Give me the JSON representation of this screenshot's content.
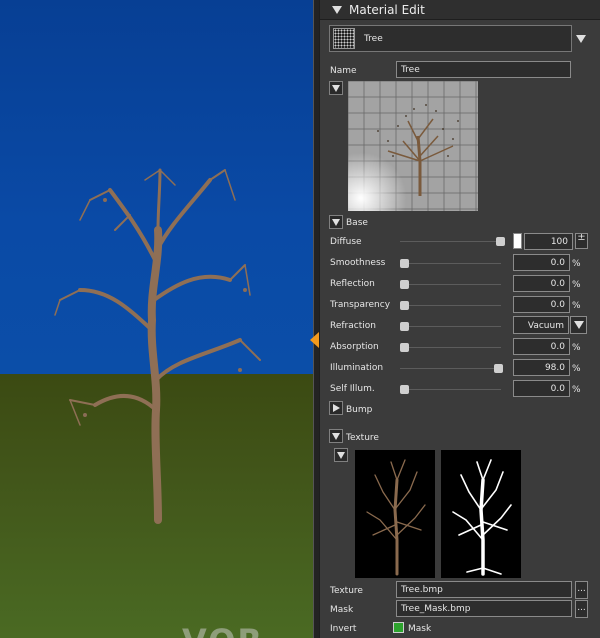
{
  "viewport": {
    "sky_color": "#0b4ea8",
    "ground_color": "#42561a",
    "watermark": "VOR"
  },
  "panel": {
    "title": "Material Edit",
    "material_selector": {
      "value": "Tree"
    },
    "name": {
      "label": "Name",
      "value": "Tree"
    },
    "sections": {
      "base": "Base",
      "bump": "Bump",
      "texture": "Texture"
    },
    "base_properties": [
      {
        "label": "Diffuse",
        "value": "100",
        "unit": "",
        "level": 1.0
      },
      {
        "label": "Smoothness",
        "value": "0.0",
        "unit": "%",
        "level": 0.0
      },
      {
        "label": "Reflection",
        "value": "0.0",
        "unit": "%",
        "level": 0.0
      },
      {
        "label": "Transparency",
        "value": "0.0",
        "unit": "%",
        "level": 0.0
      },
      {
        "label": "Refraction",
        "value": "Vacuum",
        "unit": "",
        "level": 0.0
      },
      {
        "label": "Absorption",
        "value": "0.0",
        "unit": "%",
        "level": 0.0
      },
      {
        "label": "Illumination",
        "value": "98.0",
        "unit": "%",
        "level": 0.98
      },
      {
        "label": "Self Illum.",
        "value": "0.0",
        "unit": "%",
        "level": 0.0
      }
    ],
    "diffuse_color": "#ffffff",
    "stepper_symbol": "±",
    "texture_field": {
      "label": "Texture",
      "value": "Tree.bmp"
    },
    "mask_field": {
      "label": "Mask",
      "value": "Tree_Mask.bmp"
    },
    "invert": {
      "label": "Invert",
      "checkbox_label": "Mask",
      "checked": true,
      "color": "#2ea32e"
    },
    "browse_label": "..."
  }
}
